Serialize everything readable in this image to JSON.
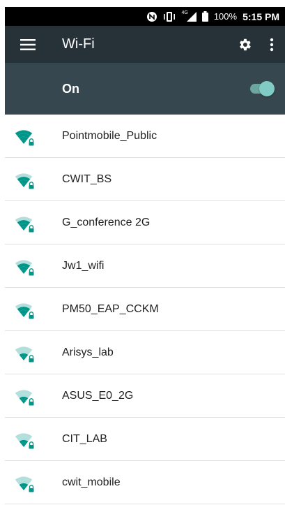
{
  "status_bar": {
    "network_label": "4G",
    "battery": "100%",
    "time": "5:15 PM",
    "icons": [
      "nfc-icon",
      "vibrate-icon",
      "cellular-signal-icon",
      "battery-icon"
    ]
  },
  "app_bar": {
    "title": "Wi-Fi",
    "icons": [
      "menu-icon",
      "gear-icon",
      "more-vert-icon"
    ]
  },
  "master_switch": {
    "label": "On",
    "state": true
  },
  "networks": [
    {
      "ssid": "Pointmobile_Public",
      "signal_bars": 4,
      "secured": true
    },
    {
      "ssid": "CWIT_BS",
      "signal_bars": 3,
      "secured": true
    },
    {
      "ssid": "G_conference 2G",
      "signal_bars": 3,
      "secured": true
    },
    {
      "ssid": "Jw1_wifi",
      "signal_bars": 3,
      "secured": true
    },
    {
      "ssid": "PM50_EAP_CCKM",
      "signal_bars": 3,
      "secured": true
    },
    {
      "ssid": "Arisys_lab",
      "signal_bars": 2,
      "secured": true
    },
    {
      "ssid": "ASUS_E0_2G",
      "signal_bars": 2,
      "secured": true
    },
    {
      "ssid": "CIT_LAB",
      "signal_bars": 2,
      "secured": true
    },
    {
      "ssid": "cwit_mobile",
      "signal_bars": 2,
      "secured": true
    }
  ],
  "colors": {
    "status_bar": "#000000",
    "app_bar": "#263238",
    "switch_bar": "#37474f",
    "accent": "#009688",
    "signal_inactive": "#b2dfdb",
    "toggle_thumb": "#80cbc4"
  }
}
